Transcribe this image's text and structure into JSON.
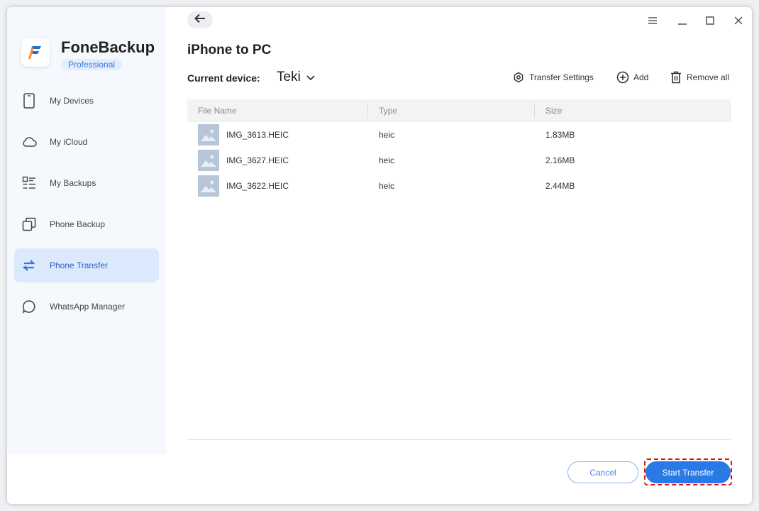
{
  "app": {
    "title": "FoneBackup",
    "badge": "Professional",
    "brand_color": "#2a7ae6"
  },
  "sidebar": {
    "items": [
      {
        "label": "My Devices",
        "icon": "phone-icon"
      },
      {
        "label": "My iCloud",
        "icon": "cloud-icon"
      },
      {
        "label": "My Backups",
        "icon": "list-icon"
      },
      {
        "label": "Phone Backup",
        "icon": "copy-icon"
      },
      {
        "label": "Phone Transfer",
        "icon": "transfer-icon",
        "active": true
      },
      {
        "label": "WhatsApp Manager",
        "icon": "chat-bubble-icon"
      }
    ]
  },
  "header": {
    "page_title": "iPhone to PC",
    "device_label": "Current device:",
    "device_value": "Teki"
  },
  "toolbar": {
    "transfer_settings": "Transfer Settings",
    "add": "Add",
    "remove_all": "Remove all"
  },
  "table": {
    "columns": [
      "File Name",
      "Type",
      "Size"
    ],
    "rows": [
      {
        "name": "IMG_3613.HEIC",
        "type": "heic",
        "size": "1.83MB"
      },
      {
        "name": "IMG_3627.HEIC",
        "type": "heic",
        "size": "2.16MB"
      },
      {
        "name": "IMG_3622.HEIC",
        "type": "heic",
        "size": "2.44MB"
      }
    ]
  },
  "footer": {
    "cancel": "Cancel",
    "start": "Start Transfer",
    "highlight_color": "#e0101a"
  }
}
